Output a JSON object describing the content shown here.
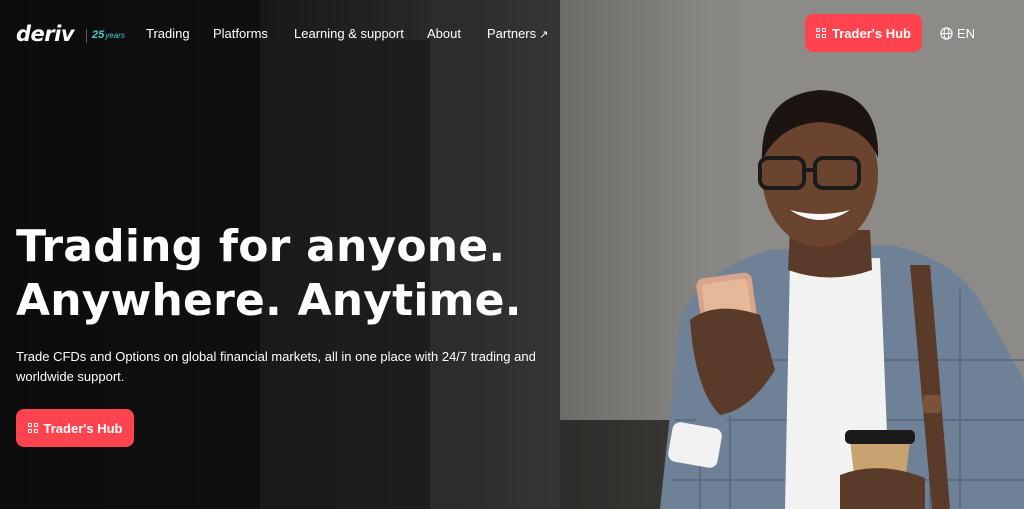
{
  "logo": {
    "brand": "deriv",
    "badge_number": "25",
    "badge_text": "years"
  },
  "nav": {
    "links": [
      {
        "label": "Trading"
      },
      {
        "label": "Platforms"
      },
      {
        "label": "Learning & support"
      },
      {
        "label": "About"
      },
      {
        "label": "Partners",
        "icon": "external-arrow-icon"
      }
    ],
    "cta_label": "Trader's Hub",
    "language": "EN"
  },
  "hero": {
    "headline_line1": "Trading for anyone.",
    "headline_line2": "Anywhere. Anytime.",
    "subtitle": "Trade CFDs and Options on global financial markets, all in one place with 24/7 trading and worldwide support.",
    "cta_label": "Trader's Hub"
  },
  "colors": {
    "accent": "#ff444f",
    "badge": "#4bc8d1",
    "text": "#ffffff"
  }
}
